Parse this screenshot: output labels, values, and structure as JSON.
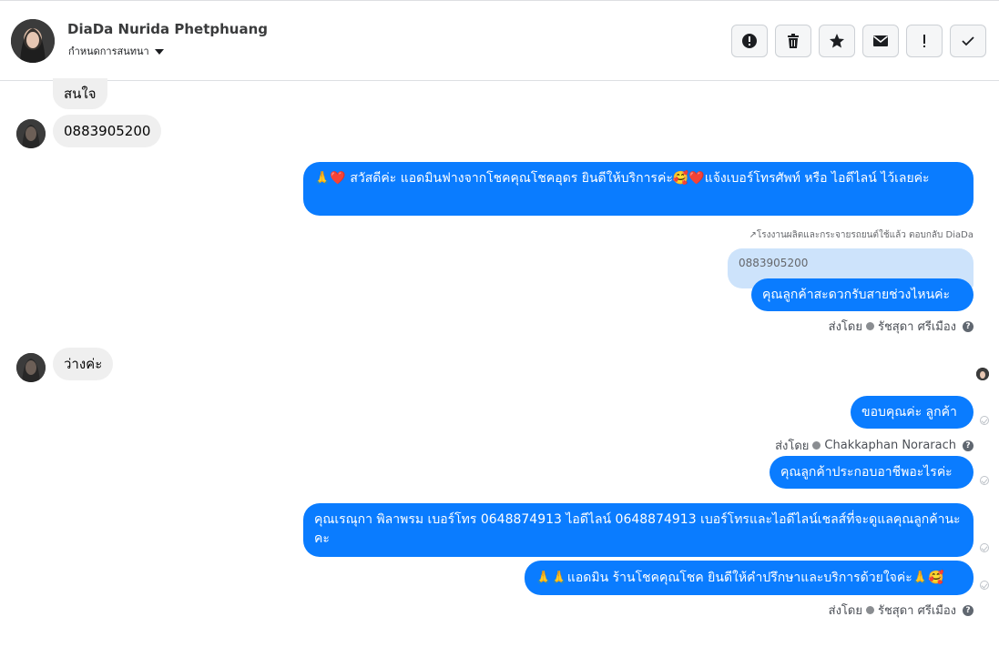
{
  "header": {
    "name": "DiaDa Nurida Phetphuang",
    "subtitle": "กำหนดการสนทนา",
    "toolbar": [
      {
        "name": "spam-alert-button",
        "icon": "alert-circle-icon"
      },
      {
        "name": "delete-button",
        "icon": "trash-icon"
      },
      {
        "name": "star-button",
        "icon": "star-icon"
      },
      {
        "name": "mark-unread-button",
        "icon": "envelope-icon"
      },
      {
        "name": "priority-button",
        "icon": "exclamation-icon"
      },
      {
        "name": "done-button",
        "icon": "checkmark-icon"
      }
    ]
  },
  "messages": {
    "in1": "สนใจ",
    "in2": "0883905200",
    "out1": "🙏❤️ สวัสดีค่ะ แอดมินฟางจากโชคคุณโชคอุดร ยินดีให้บริการค่ะ🥰❤️แจ้งเบอร์โทรศัพท์ หรือ ไอดีไลน์  ไว้เลยค่ะ",
    "reply_note": "โรงงานผลิตและกระจายรถยนต์ใช้แล้ว ตอบกลับ DiaDa",
    "quote": "0883905200",
    "out2": "คุณลูกค้าสะดวกรับสายช่วงไหนค่ะ",
    "sent_by_1": "ส่งโดย",
    "sender_1": "รัชสุดา ศรีเมือง",
    "in3": "ว่างค่ะ",
    "out3": "ขอบคุณค่ะ ลูกค้า",
    "sent_by_2": "ส่งโดย",
    "sender_2": "Chakkaphan Norarach",
    "out4": "คุณลูกค้าประกอบอาชีพอะไรค่ะ",
    "out5": "คุณเรณุกา พิลาพรม        เบอร์โทร 0648874913  ไอดีไลน์ 0648874913   เบอร์โทรและไอดีไลน์เชลส์ที่จะดูแลคุณลูกค้านะคะ",
    "out6": "🙏🙏แอดมิน ร้านโชคคุณโชค ยินดีให้คำปรึกษาและบริการด้วยใจค่ะ🙏🥰",
    "sent_by_3": "ส่งโดย",
    "sender_3": "รัชสุดา ศรีเมือง"
  },
  "colors": {
    "outgoing_bubble": "#0a7cff",
    "incoming_bubble": "#efefef",
    "quote_bg": "#cde3fb"
  }
}
